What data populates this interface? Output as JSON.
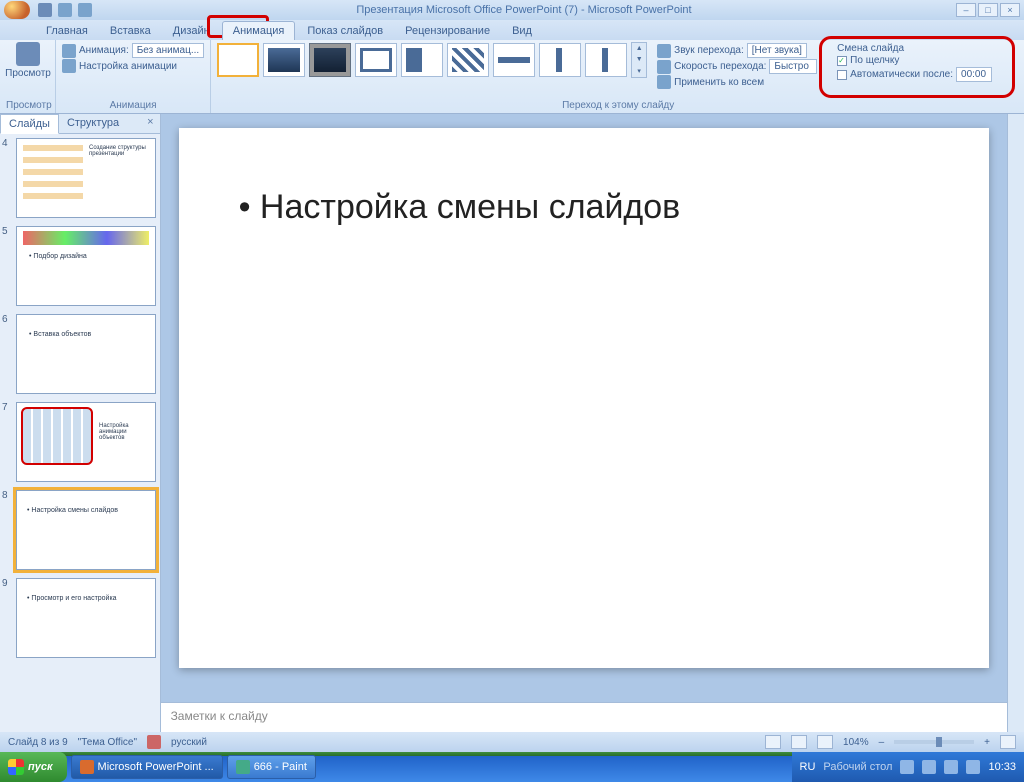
{
  "title": "Презентация Microsoft Office PowerPoint (7) - Microsoft PowerPoint",
  "tabs": [
    "Главная",
    "Вставка",
    "Дизайн",
    "Анимация",
    "Показ слайдов",
    "Рецензирование",
    "Вид"
  ],
  "active_tab": "Анимация",
  "ribbon": {
    "preview_label": "Просмотр",
    "anim_label": "Анимация:",
    "anim_value": "Без анимац...",
    "anim_settings": "Настройка анимации",
    "group_anim": "Анимация",
    "group_transition": "Переход к этому слайду",
    "sound_label": "Звук перехода:",
    "sound_value": "[Нет звука]",
    "speed_label": "Скорость перехода:",
    "speed_value": "Быстро",
    "apply_all": "Применить ко всем",
    "advance_title": "Смена слайда",
    "on_click": "По щелчку",
    "auto_after": "Автоматически после:",
    "auto_time": "00:00"
  },
  "side_tabs": {
    "slides": "Слайды",
    "outline": "Структура"
  },
  "thumbs": [
    {
      "num": "4",
      "text": "Создание структуры презентации"
    },
    {
      "num": "5",
      "text": "Подбор дизайна"
    },
    {
      "num": "6",
      "text": "Вставка объектов"
    },
    {
      "num": "7",
      "text": "Настройка анимации объектов"
    },
    {
      "num": "8",
      "text": "Настройка смены слайдов",
      "sel": true
    },
    {
      "num": "9",
      "text": "Просмотр и его настройка"
    }
  ],
  "slide_text": "Настройка смены слайдов",
  "notes_placeholder": "Заметки к слайду",
  "status": {
    "slide": "Слайд 8 из 9",
    "theme": "\"Тема Office\"",
    "lang": "русский",
    "zoom": "104%"
  },
  "taskbar": {
    "start": "пуск",
    "items": [
      "Microsoft PowerPoint ...",
      "666 - Paint"
    ],
    "tray_lang": "RU",
    "tray_desk": "Рабочий стол",
    "time": "10:33"
  }
}
